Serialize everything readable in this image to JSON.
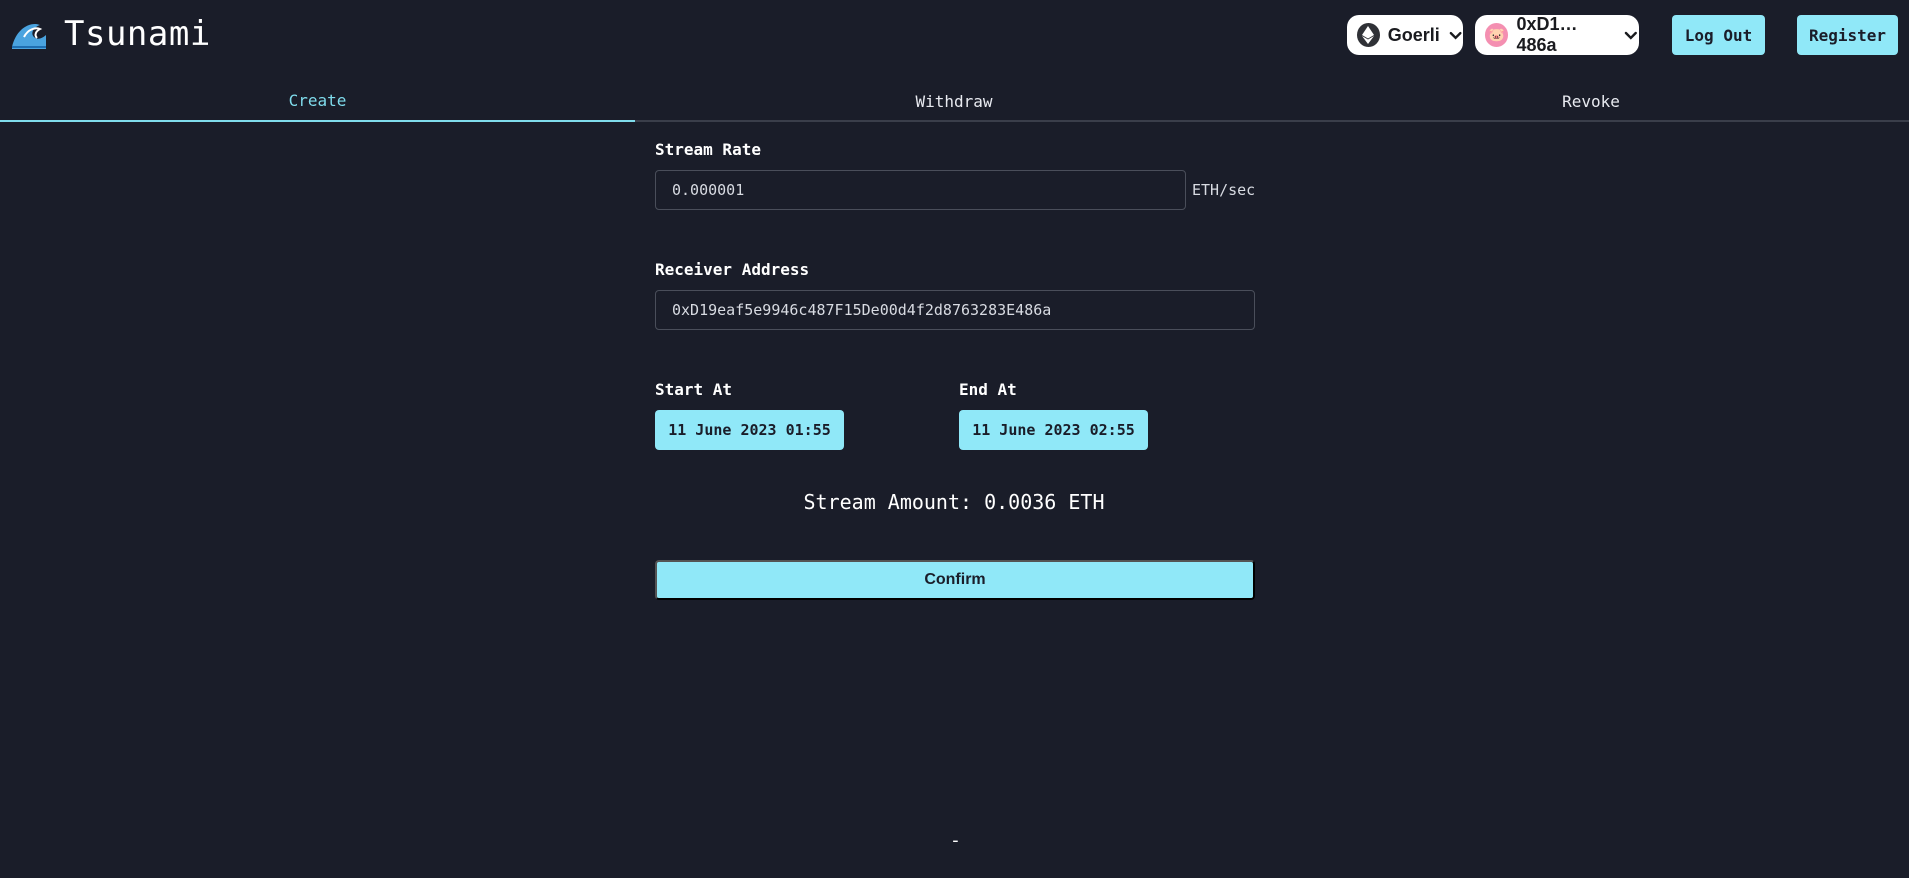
{
  "header": {
    "logo_text": "Tsunami",
    "chain_label": "Goerli",
    "account_label": "0xD1…486a",
    "logout_label": "Log Out",
    "register_label": "Register"
  },
  "tabs": [
    {
      "label": "Create",
      "active": true
    },
    {
      "label": "Withdraw",
      "active": false
    },
    {
      "label": "Revoke",
      "active": false
    }
  ],
  "form": {
    "stream_rate_label": "Stream Rate",
    "stream_rate_value": "0.000001",
    "stream_rate_unit": "ETH/sec",
    "receiver_label": "Receiver Address",
    "receiver_value": "0xD19eaf5e9946c487F15De00d4f2d8763283E486a",
    "start_label": "Start At",
    "start_value": "11 June 2023 01:55",
    "end_label": "End At",
    "end_value": "11 June 2023 02:55",
    "amount_text": "Stream Amount: 0.0036 ETH",
    "confirm_label": "Confirm"
  },
  "footer": {
    "dash": "-"
  },
  "colors": {
    "background": "#1a1d29",
    "accent": "#90e8f8",
    "active_tab": "#7fdcec"
  }
}
